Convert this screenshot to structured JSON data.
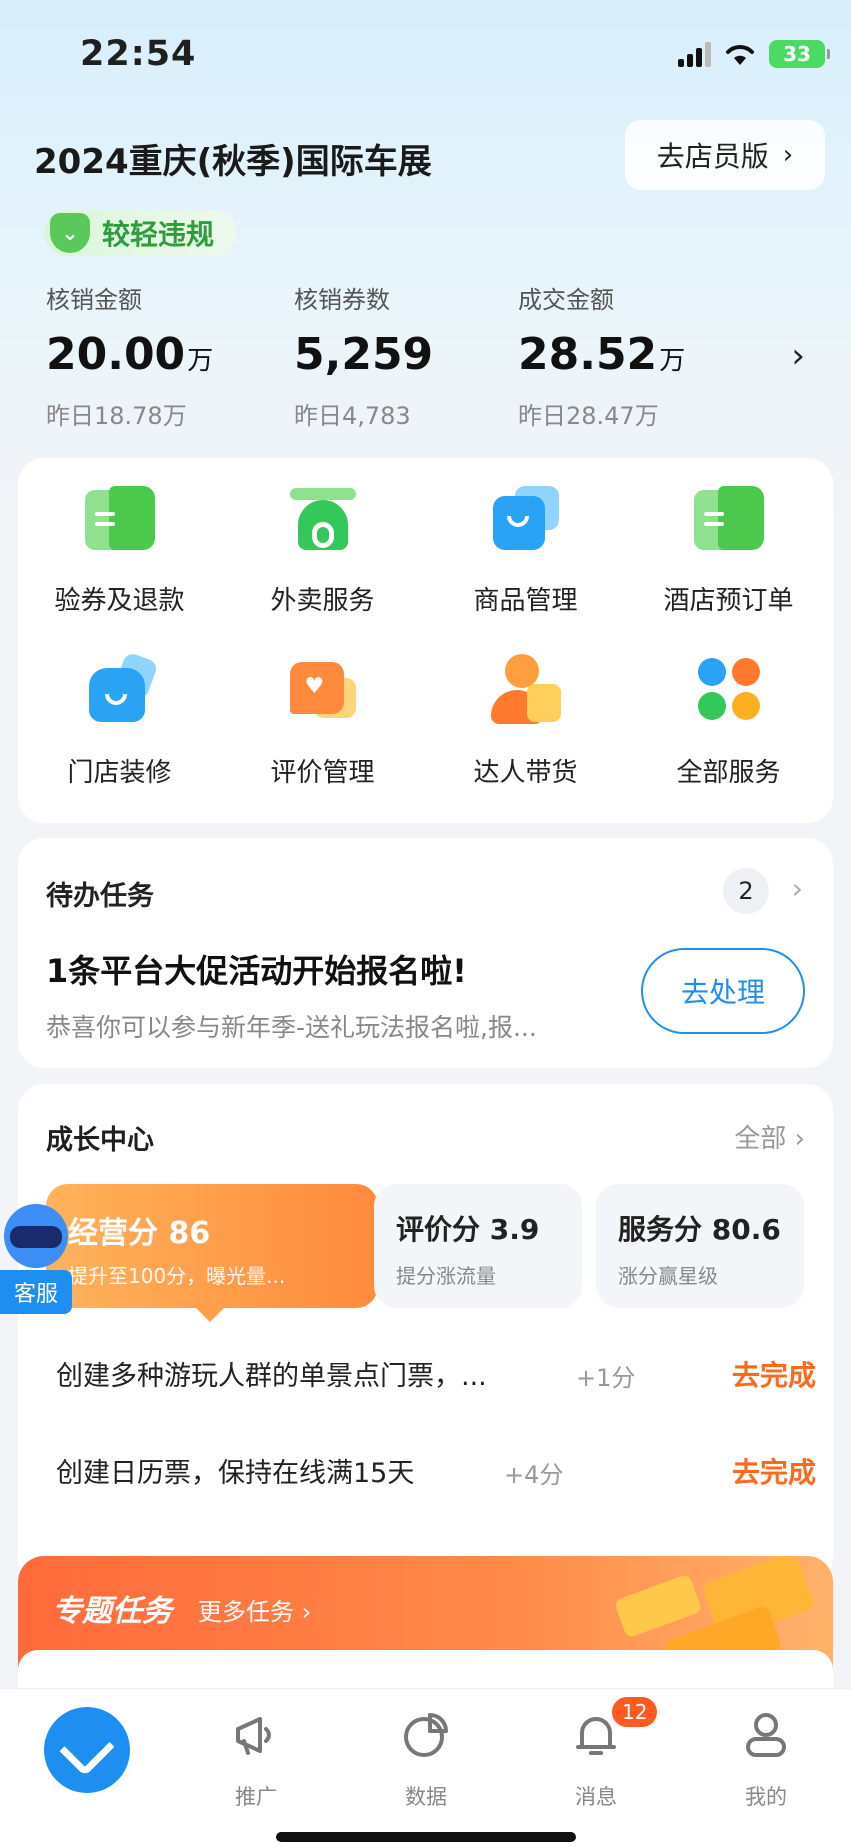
{
  "status_bar": {
    "time": "22:54",
    "battery": "33"
  },
  "header": {
    "title": "2024重庆(秋季)国际车展",
    "clerk_button": "去店员版",
    "violation_badge": "较轻违规"
  },
  "stats": [
    {
      "label": "核销金额",
      "value": "20.00",
      "unit": "万",
      "prev": "昨日18.78万"
    },
    {
      "label": "核销券数",
      "value": "5,259",
      "unit": "",
      "prev": "昨日4,783"
    },
    {
      "label": "成交金额",
      "value": "28.52",
      "unit": "万",
      "prev": "昨日28.47万"
    }
  ],
  "services": [
    {
      "label": "验券及退款",
      "icon": "ticket-icon"
    },
    {
      "label": "外卖服务",
      "icon": "scooter-icon"
    },
    {
      "label": "商品管理",
      "icon": "bag-icon"
    },
    {
      "label": "酒店预订单",
      "icon": "ticket-icon"
    },
    {
      "label": "门店装修",
      "icon": "house-icon"
    },
    {
      "label": "评价管理",
      "icon": "review-icon"
    },
    {
      "label": "达人带货",
      "icon": "expert-icon"
    },
    {
      "label": "全部服务",
      "icon": "grid-icon"
    }
  ],
  "todo": {
    "title": "待办任务",
    "count": "2",
    "task_title": "1条平台大促活动开始报名啦!",
    "task_desc": "恭喜你可以参与新年季-送礼玩法报名啦,报...",
    "action": "去处理"
  },
  "growth": {
    "title": "成长中心",
    "all_label": "全部",
    "business_score_label": "经营分",
    "business_score": "86",
    "business_score_hint": "提升至100分，曝光量...",
    "review_score_label": "评价分",
    "review_score": "3.9",
    "review_score_hint": "提分涨流量",
    "service_score_label": "服务分",
    "service_score": "80.6",
    "service_score_hint": "涨分赢星级",
    "tasks": [
      {
        "title": "创建多种游玩人群的单景点门票，...",
        "points": "+1分",
        "action": "去完成"
      },
      {
        "title": "创建日历票，保持在线满15天",
        "points": "+4分",
        "action": "去完成"
      }
    ]
  },
  "topic": {
    "title": "专题任务",
    "more": "更多任务"
  },
  "helper": {
    "label": "客服"
  },
  "tabbar": {
    "items": [
      {
        "label": "推广",
        "icon": "megaphone-icon"
      },
      {
        "label": "数据",
        "icon": "pie-chart-icon"
      },
      {
        "label": "消息",
        "icon": "bell-icon"
      },
      {
        "label": "我的",
        "icon": "user-icon"
      }
    ],
    "notification_count": "12"
  },
  "colors": {
    "accent": "#1e8ef0",
    "orange": "#ff6a1a",
    "green": "#34c759"
  }
}
